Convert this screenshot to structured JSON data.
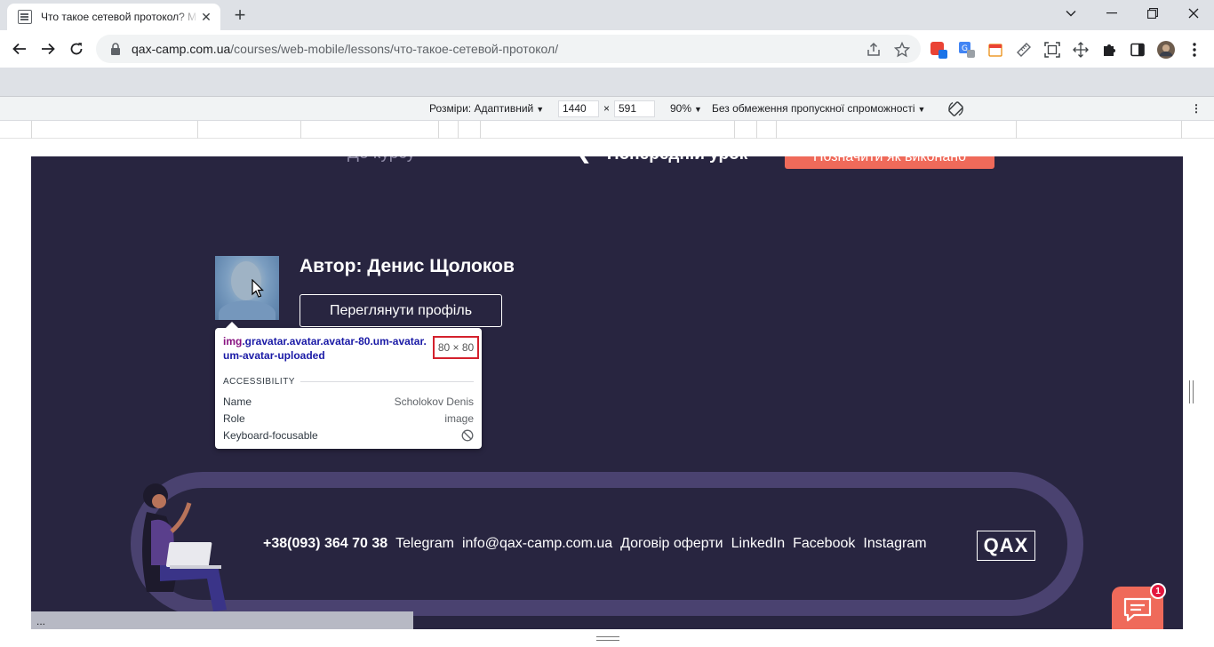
{
  "browser": {
    "tab_title": "Что такое сетевой протокол? М",
    "new_tab_glyph": "+",
    "tab_close_glyph": "✕",
    "url_host": "qax-camp.com.ua",
    "url_path": "/courses/web-mobile/lessons/что-такое-сетевой-протокол/",
    "window_controls": [
      "minimize",
      "restore",
      "close"
    ]
  },
  "device_toolbar": {
    "dimensions_label": "Розміри: Адаптивний",
    "width_value": "1440",
    "times_glyph": "×",
    "height_value": "591",
    "zoom": "90%",
    "throttling": "Без обмеження пропускної спроможності",
    "more_glyph": "⋮"
  },
  "page": {
    "lesson_nav": {
      "back_to_course": "До курсу",
      "prev_lesson": "Попередній урок",
      "mark_done": "Позначити як виконано"
    },
    "author": {
      "name_label": "Автор: Денис Щолоков",
      "profile_button": "Переглянути профіль"
    },
    "footer": {
      "phone": "+38(093) 364 70 38",
      "telegram": "Telegram",
      "email": "info@qax-camp.com.ua",
      "offer": "Договір оферти",
      "linkedin": "LinkedIn",
      "facebook": "Facebook",
      "instagram": "Instagram",
      "logo": "QAX"
    },
    "chat_badge": "1"
  },
  "inspect_tooltip": {
    "tag": "img",
    "classes": ".gravatar.avatar.avatar-80.um-avatar.um-avatar-uploaded",
    "size": "80 × 80",
    "section_title": "ACCESSIBILITY",
    "rows": [
      {
        "label": "Name",
        "value": "Scholokov Denis"
      },
      {
        "label": "Role",
        "value": "image"
      },
      {
        "label": "Keyboard-focusable",
        "value": ""
      }
    ]
  },
  "status_bar": {
    "text": "..."
  },
  "colors": {
    "page_bg": "#282540",
    "accent": "#ef6a5a",
    "footer_ring": "#4a4270",
    "highlight": "#6fa8dc",
    "size_box_border": "#d4212d"
  }
}
